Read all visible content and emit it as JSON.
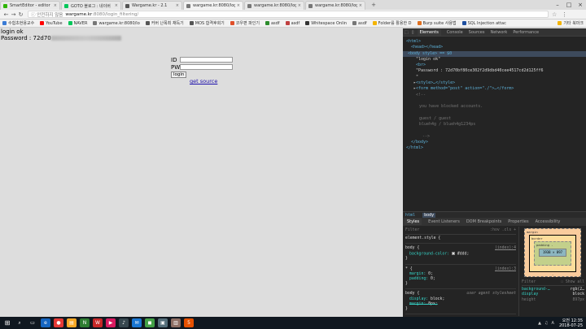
{
  "tabs": [
    {
      "title": "SmartEditor - editor",
      "color": "#2db400"
    },
    {
      "title": "GOTO 블로그 : 네이버",
      "color": "#03c75a"
    },
    {
      "title": "Wargame.kr - 2.1",
      "color": "#555555"
    },
    {
      "title": "wargame.kr:8080/login_",
      "color": "#777777",
      "active": true
    },
    {
      "title": "wargame.kr:8080/login_",
      "color": "#777777"
    },
    {
      "title": "wargame.kr:8080/login",
      "color": "#777777"
    }
  ],
  "omnibox": {
    "secure_label": "ⓘ 안전하지 않음",
    "host": "wargame.kr",
    "path": ":8080/login_filtering/"
  },
  "bookmarks": [
    {
      "label": "수험초현용교수",
      "color": "#3a7bd5"
    },
    {
      "label": "YouTube",
      "color": "#ff0000"
    },
    {
      "label": "NAVER",
      "color": "#03c75a"
    },
    {
      "label": "wargame.kr:8080/lo",
      "color": "#777777"
    },
    {
      "label": "커버 난폭최 채득기",
      "color": "#555555"
    },
    {
      "label": "MOS 합격후회기",
      "color": "#555555"
    },
    {
      "label": "코우편 파인기",
      "color": "#e0502a"
    },
    {
      "label": "asdf",
      "color": "#2c8c2c"
    },
    {
      "label": "asdf",
      "color": "#c04040"
    },
    {
      "label": "Whitespace Onlin",
      "color": "#333333"
    },
    {
      "label": "asdf",
      "color": "#777777"
    },
    {
      "label": "Folder를 활용한 D",
      "color": "#f4b400"
    },
    {
      "label": "Burp suite 사용법",
      "color": "#e07020"
    },
    {
      "label": "SQL Injection attac",
      "color": "#1e4fa0"
    }
  ],
  "bookmarks_other": "기타 북마크",
  "page": {
    "status_line": "login ok",
    "password_label": "Password : 72d70",
    "id_label": "ID",
    "pw_label": "PW",
    "login_button": "login",
    "source_link": "get source"
  },
  "devtools": {
    "tabs": [
      "Elements",
      "Console",
      "Sources",
      "Network",
      "Performance"
    ],
    "active_tab": "Elements",
    "dom": {
      "html_open": "<html>",
      "head": "<head></head>",
      "body_open": "<body style> == $0",
      "text_login": "\"login ok\"",
      "br": "<br>",
      "text_password": "\"Password : 72d70bf80ce302f2d9dbd40cee4517cd2d125ff6",
      "text_close": "\"",
      "style": "<style>…</style>",
      "form": "<form method=\"post\" action=\"./\">…</form>",
      "comment_open": "<!--",
      "comment_blocked": "you have blocked accounts.",
      "comment_guest": "guest / guest",
      "comment_blue": "blueh4g / blueh4g1234ps",
      "comment_close": "-->",
      "body_close": "</body>",
      "html_close": "</html>"
    },
    "breadcrumbs": [
      "html",
      "body"
    ],
    "style_tabs": [
      "Styles",
      "Event Listeners",
      "DOM Breakpoints",
      "Properties",
      "Accessibility"
    ],
    "filter_placeholder": "Filter",
    "filter_options": ":hov  .cls  +",
    "rules": [
      {
        "selector": "element.style {",
        "source": "",
        "props": []
      },
      {
        "selector": "body {",
        "source": "(index):4",
        "props": [
          {
            "name": "background-color",
            "value": "#ddd;",
            "swatch": true
          }
        ]
      },
      {
        "selector": "* {",
        "source": "(index):3",
        "props": [
          {
            "name": "margin",
            "value": "0;"
          },
          {
            "name": "padding",
            "value": "0;"
          }
        ]
      },
      {
        "selector": "body {",
        "source": "user agent stylesheet",
        "props": [
          {
            "name": "display",
            "value": "block;"
          },
          {
            "name": "margin",
            "value": "8px;",
            "strike": true
          }
        ]
      }
    ],
    "box_model": {
      "margin_label": "margin",
      "border_label": "border",
      "padding_label": "padding -",
      "content": "1938 × 897",
      "dash": "-"
    },
    "computed_filter": "Filter",
    "computed_show_all": "Show all",
    "computed": [
      {
        "prop": "background-…",
        "value": "rgb(2…",
        "swatch": true
      },
      {
        "prop": "display",
        "value": "block"
      },
      {
        "prop": "height",
        "value": "897px",
        "dim": true
      }
    ]
  },
  "taskbar": {
    "clock_time": "오전 12:35",
    "clock_date": "2018-07-25",
    "icons": [
      {
        "glyph": "⌕",
        "color": "#101820"
      },
      {
        "glyph": "▭",
        "color": "#101820"
      },
      {
        "glyph": "e",
        "color": "#1565c0"
      },
      {
        "glyph": "●",
        "color": "#e53935"
      },
      {
        "glyph": "▤",
        "color": "#f9a825"
      },
      {
        "glyph": "N",
        "color": "#2e7d32"
      },
      {
        "glyph": "W",
        "color": "#c62828"
      },
      {
        "glyph": "▶",
        "color": "#d81b60"
      },
      {
        "glyph": "♪",
        "color": "#37474f"
      },
      {
        "glyph": "✉",
        "color": "#1976d2"
      },
      {
        "glyph": "◼",
        "color": "#43a047"
      },
      {
        "glyph": "▣",
        "color": "#546e7a"
      },
      {
        "glyph": "▥",
        "color": "#8d6e63"
      },
      {
        "glyph": "5",
        "color": "#e65100"
      }
    ]
  }
}
